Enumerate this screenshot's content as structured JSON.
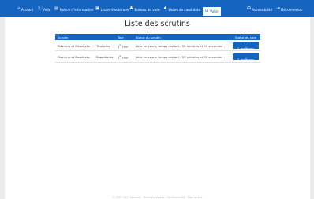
{
  "nav": {
    "home": {
      "label": "Accueil",
      "icon": "house-icon"
    },
    "help": {
      "label": "Aide",
      "icon": "question-circle-icon"
    },
    "info": {
      "label": "Notice d'information",
      "icon": "document-icon"
    },
    "lists": {
      "label": "Listes électorales",
      "icon": "address-card-icon"
    },
    "office": {
      "label": "Bureau de vote",
      "icon": "people-icon"
    },
    "candidates": {
      "label": "Listes de candidats",
      "icon": "people-group-icon"
    },
    "vote": {
      "label": "Voter",
      "icon": "ballot-box-icon"
    },
    "accessibility": {
      "label": "Accessibilité",
      "icon": "accessibility-icon"
    },
    "logout": {
      "label": "Déconnexion",
      "icon": "logout-icon"
    }
  },
  "page_title": "Liste des scrutins",
  "table": {
    "headers": {
      "scrutin": "Scrutin",
      "tour": "Tour",
      "statut_scrutin": "Statut du scrutin",
      "statut_vote": "Statut du vote"
    },
    "rows": [
      {
        "college": "Ouvriers et Employés",
        "type": "Titulaires",
        "tour_num": "1",
        "tour_sup": "er",
        "tour_word": "tour",
        "status": "Vote en cours, temps restant : 59 minutes et 59 secondes",
        "action": "A exprimer"
      },
      {
        "college": "Ouvriers et Employés",
        "type": "Suppléants",
        "tour_num": "1",
        "tour_sup": "er",
        "tour_word": "tour",
        "status": "Vote en cours, temps restant : 59 minutes et 59 secondes",
        "action": "A exprimer"
      }
    ]
  },
  "footer": "© 2007-2017 Neovote · Mentions légales · Confidentialité · Plan du site",
  "colors": {
    "primary": "#1565c0",
    "background": "#e9ebee"
  }
}
